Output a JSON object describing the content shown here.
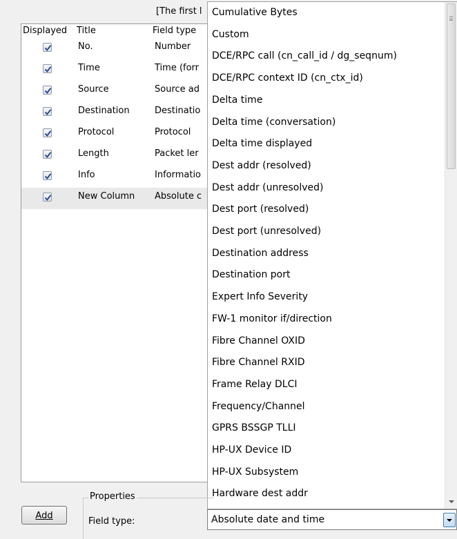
{
  "header_note": "[The first l",
  "columns_list": {
    "headers": {
      "displayed": "Displayed",
      "title": "Title",
      "field_type": "Field type"
    },
    "rows": [
      {
        "displayed": true,
        "title": "No.",
        "field_type": "Number"
      },
      {
        "displayed": true,
        "title": "Time",
        "field_type": "Time (forr"
      },
      {
        "displayed": true,
        "title": "Source",
        "field_type": "Source ad"
      },
      {
        "displayed": true,
        "title": "Destination",
        "field_type": "Destinatio"
      },
      {
        "displayed": true,
        "title": "Protocol",
        "field_type": "Protocol"
      },
      {
        "displayed": true,
        "title": "Length",
        "field_type": "Packet ler"
      },
      {
        "displayed": true,
        "title": "Info",
        "field_type": "Informatio"
      },
      {
        "displayed": true,
        "title": "New Column",
        "field_type": "Absolute c",
        "selected": true
      }
    ]
  },
  "dropdown": {
    "options": [
      "Cumulative Bytes",
      "Custom",
      "DCE/RPC call (cn_call_id / dg_seqnum)",
      "DCE/RPC context ID (cn_ctx_id)",
      "Delta time",
      "Delta time (conversation)",
      "Delta time displayed",
      "Dest addr (resolved)",
      "Dest addr (unresolved)",
      "Dest port (resolved)",
      "Dest port (unresolved)",
      "Destination address",
      "Destination port",
      "Expert Info Severity",
      "FW-1 monitor if/direction",
      "Fibre Channel OXID",
      "Fibre Channel RXID",
      "Frame Relay DLCI",
      "Frequency/Channel",
      "GPRS BSSGP TLLI",
      "HP-UX Device ID",
      "HP-UX Subsystem",
      "Hardware dest addr"
    ]
  },
  "buttons": {
    "add": "Add"
  },
  "properties": {
    "legend": "Properties",
    "field_type_label": "Field type:",
    "field_type_value": "Absolute date and time"
  },
  "colors": {
    "accent": "#3c7fb1",
    "checkbox_check": "#2b4a8b",
    "selected_row": "#e9e9e9"
  }
}
